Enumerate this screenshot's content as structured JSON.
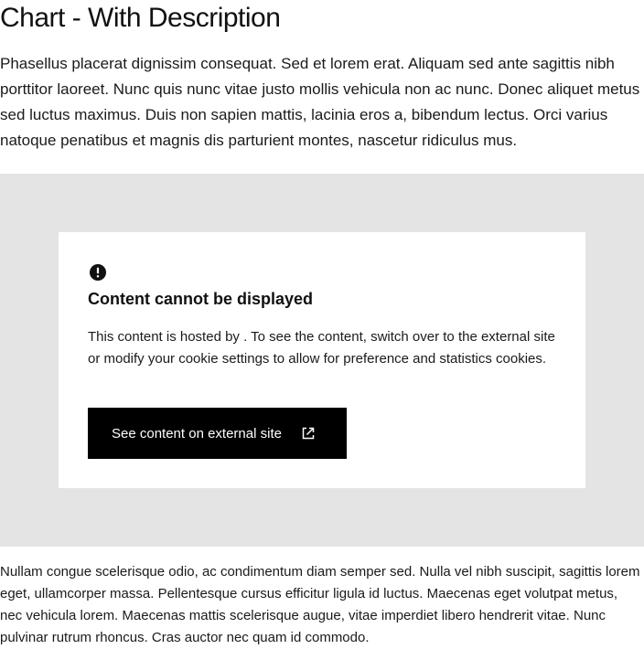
{
  "page": {
    "title": "Chart - With Description",
    "description": "Phasellus placerat dignissim consequat. Sed et lorem erat. Aliquam sed ante sagittis nibh porttitor laoreet. Nunc quis nunc vitae justo mollis vehicula non ac nunc. Donec aliquet metus sed luctus maximus. Duis non sapien mattis, lacinia eros a, bibendum lectus. Orci varius natoque penatibus et magnis dis parturient montes, nascetur ridiculus mus.",
    "footer_text": "Nullam congue scelerisque odio, ac condimentum diam semper sed. Nulla vel nibh suscipit, sagittis lorem eget, ullamcorper massa. Pellentesque cursus efficitur ligula id luctus. Maecenas eget volutpat metus, nec vehicula lorem. Maecenas mattis scelerisque augue, vitae imperdiet libero hendrerit vitae. Nunc pulvinar rutrum rhoncus. Cras auctor nec quam id commodo."
  },
  "consent_card": {
    "icon": "alert-circle-icon",
    "heading": "Content cannot be displayed",
    "message": "This content is hosted by . To see the content, switch over to the external site or modify your cookie settings to allow for preference and statistics cookies.",
    "button_label": "See content on external site",
    "button_icon": "external-link-icon"
  },
  "colors": {
    "placeholder_background": "#e4e4e4",
    "card_background": "#ffffff",
    "button_background": "#000000",
    "button_text": "#ffffff"
  }
}
